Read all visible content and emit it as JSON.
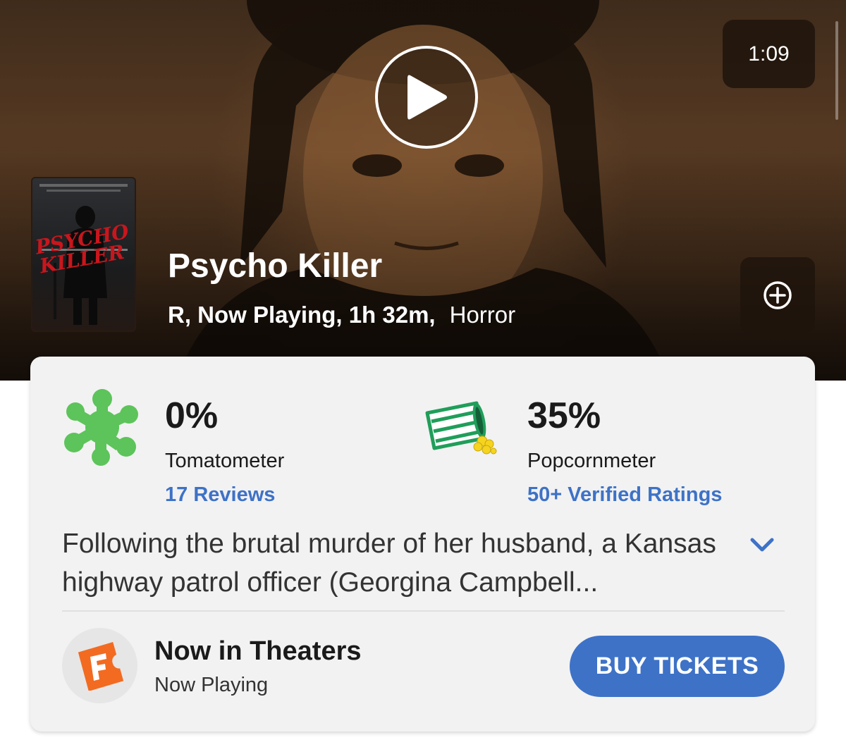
{
  "hero": {
    "duration": "1:09",
    "title": "Psycho Killer",
    "meta_primary": "R, Now Playing, 1h 32m,",
    "meta_genre": "Horror",
    "poster_title_line1": "PSYCHO",
    "poster_title_line2": "KILLER",
    "play_icon": "play-icon",
    "add_icon": "plus-circle-icon"
  },
  "scores": {
    "tomatometer": {
      "value": "0%",
      "label": "Tomatometer",
      "link": "17 Reviews",
      "icon": "splat-icon",
      "color": "#5cc45a"
    },
    "popcornmeter": {
      "value": "35%",
      "label": "Popcornmeter",
      "link": "50+ Verified Ratings",
      "icon": "spilled-popcorn-icon",
      "color": "#1f9e5a"
    }
  },
  "synopsis": {
    "text": "Following the brutal murder of her husband, a Kansas highway patrol officer (Georgina Campbell...",
    "expand_icon": "chevron-down-icon"
  },
  "theaters": {
    "title": "Now in Theaters",
    "subtitle": "Now Playing",
    "button": "BUY TICKETS",
    "logo_icon": "fandango-logo",
    "accent": "#3d72c7"
  }
}
